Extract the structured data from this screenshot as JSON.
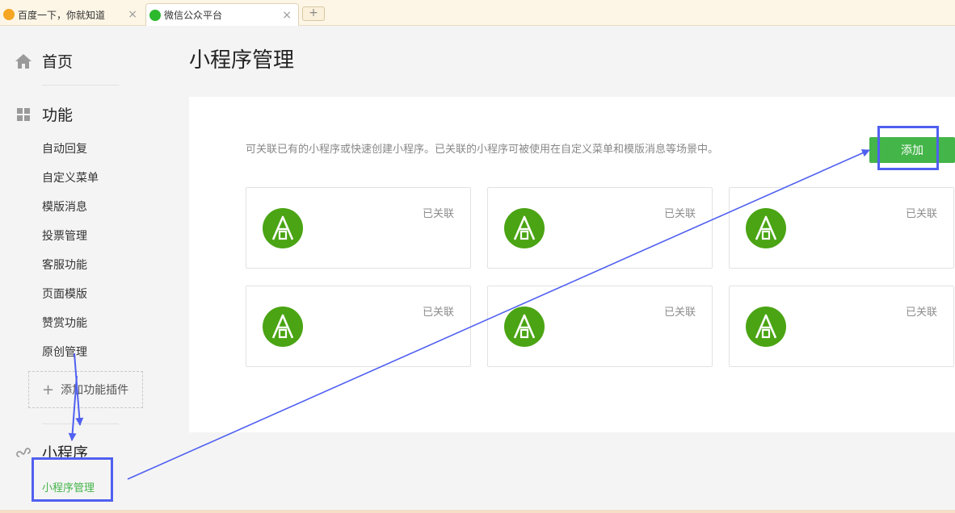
{
  "browser": {
    "tabs": [
      {
        "label": "百度一下，你就知道",
        "close": "×",
        "icon": "baidu-icon"
      },
      {
        "label": "微信公众平台",
        "close": "×",
        "icon": "wechat-icon"
      }
    ],
    "new_tab": "+"
  },
  "sidebar": {
    "home": {
      "label": "首页",
      "icon": "home-icon"
    },
    "features": {
      "label": "功能",
      "icon": "grid-icon",
      "items": [
        "自动回复",
        "自定义菜单",
        "模版消息",
        "投票管理",
        "客服功能",
        "页面模版",
        "赞赏功能",
        "原创管理"
      ],
      "add_plugin_plus": "+",
      "add_plugin": "添加功能插件"
    },
    "miniprogram": {
      "label": "小程序",
      "icon": "link-icon",
      "active_item": "小程序管理"
    }
  },
  "main": {
    "title": "小程序管理",
    "description": "可关联已有的小程序或快速创建小程序。已关联的小程序可被使用在自定义菜单和模版消息等场景中。",
    "add_button": "添加",
    "cards": [
      {
        "status": "已关联"
      },
      {
        "status": "已关联"
      },
      {
        "status": "已关联"
      },
      {
        "status": "已关联"
      },
      {
        "status": "已关联"
      },
      {
        "status": "已关联"
      }
    ]
  },
  "colors": {
    "accent_green": "#44b549",
    "logo_green": "#4aa413",
    "annotation_blue": "#5060f0"
  }
}
